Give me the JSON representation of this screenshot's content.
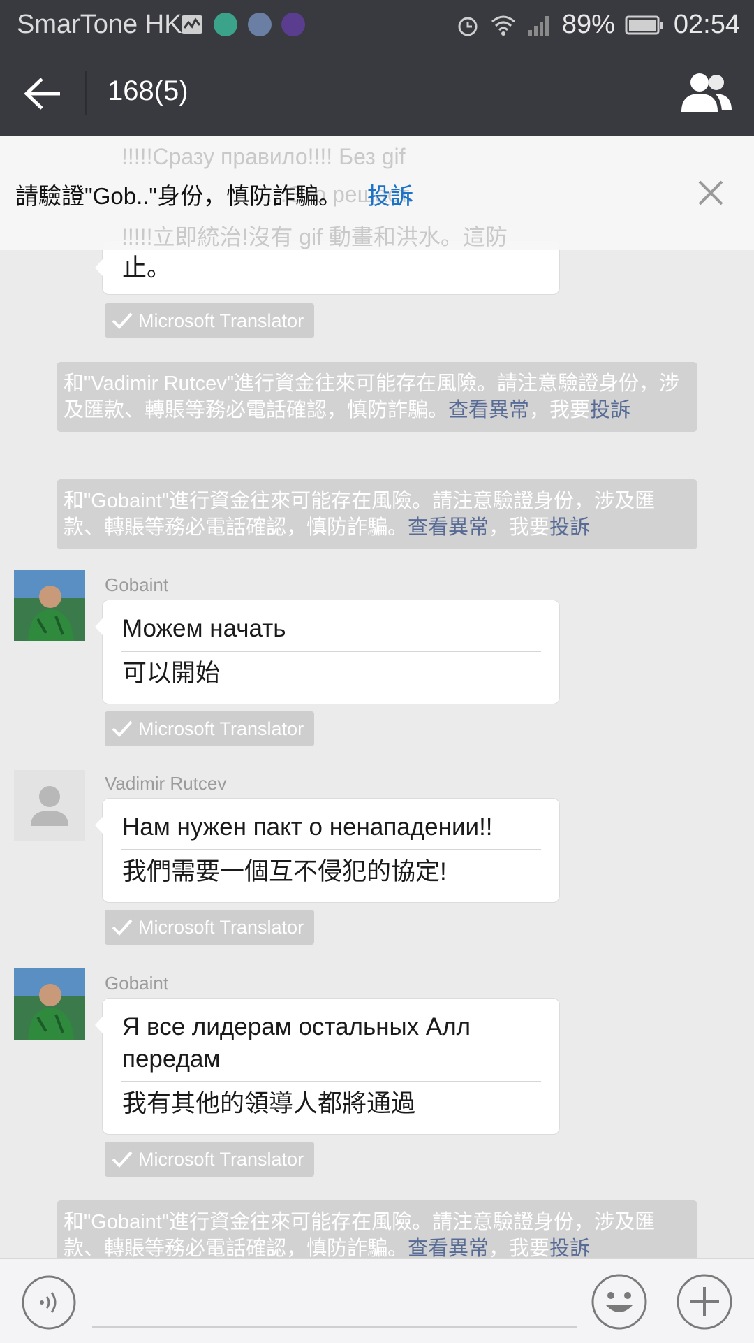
{
  "status_bar": {
    "carrier": "SmarTone HK",
    "battery": "89%",
    "time": "02:54"
  },
  "header": {
    "title": "168(5)",
    "back_icon": "arrow-left-icon",
    "members_icon": "group-members-icon"
  },
  "banner": {
    "text": "請驗證\"Gob..\"身份，慎防詐騙。",
    "complain": "投訴",
    "ghost_lines": [
      "!!!!!Сразу правило!!!! Без gif",
      "…Это решает.",
      "!!!!!立即統治!沒有 gif 動畫和洪水。這防"
    ]
  },
  "messages": {
    "m0": {
      "translation": "止。"
    },
    "note1": {
      "text": "和\"Vadimir Rutcev\"進行資金往來可能存在風險。請注意驗證身份，涉及匯款、轉賬等務必電話確認，慎防詐騙。",
      "view": "查看異常",
      "sep": "，我要",
      "complain": "投訴"
    },
    "note2": {
      "text": "和\"Gobaint\"進行資金往來可能存在風險。請注意驗證身份，涉及匯款、轉賬等務必電話確認，慎防詐騙。",
      "view": "查看異常",
      "sep": "，我要",
      "complain": "投訴"
    },
    "m1": {
      "sender": "Gobaint",
      "original": "Можем начать",
      "translation": "可以開始"
    },
    "m2": {
      "sender": "Vadimir Rutcev",
      "original": "Нам нужен пакт о ненападении!!",
      "translation": "我們需要一個互不侵犯的協定!"
    },
    "m3": {
      "sender": "Gobaint",
      "original": "Я все лидерам остальных Алл передам",
      "translation": "我有其他的領導人都將通過"
    },
    "note3": {
      "text": "和\"Gobaint\"進行資金往來可能存在風險。請注意驗證身份，涉及匯款、轉賬等務必電話確認，慎防詐騙。",
      "view": "查看異常",
      "sep": "，我要",
      "complain": "投訴"
    }
  },
  "translator_label": "Microsoft Translator",
  "colors": {
    "bar": "#393a3f",
    "link": "#576b95",
    "complain_blue": "#1a73c9",
    "chat_bg": "#ebebeb"
  }
}
